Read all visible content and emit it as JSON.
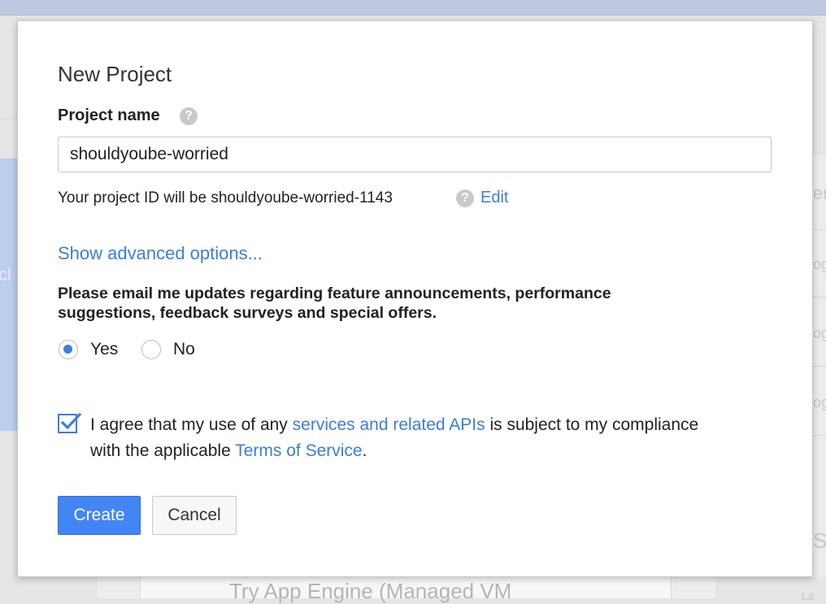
{
  "background": {
    "sidebar_partial_text": "cl",
    "right_partial_texts": [
      "er",
      "og",
      "og",
      "og",
      "St"
    ],
    "card_title_partial": "Try App Engine (Managed VM",
    "right_card_partial": "La"
  },
  "dialog": {
    "title": "New Project",
    "project_name_label": "Project name",
    "project_name_value": "shouldyoube-worried",
    "project_id_text": "Your project ID will be shouldyoube-worried-1143",
    "edit_link": "Edit",
    "advanced_options_link": "Show advanced options...",
    "email_prompt": "Please email me updates regarding feature announcements, performance suggestions, feedback surveys and special offers.",
    "email_options": [
      {
        "label": "Yes",
        "selected": true
      },
      {
        "label": "No",
        "selected": false
      }
    ],
    "agree": {
      "checked": true,
      "text_1": "I agree that my use of any ",
      "link_1": "services and related APIs",
      "text_2": " is subject to my compliance with the applicable ",
      "link_2": "Terms of Service",
      "text_3": "."
    },
    "create_button": "Create",
    "cancel_button": "Cancel"
  },
  "colors": {
    "accent": "#4285f4",
    "link": "#3a7ddf"
  },
  "icons": {
    "help": "help-circle-icon",
    "check": "checkmark-icon"
  }
}
